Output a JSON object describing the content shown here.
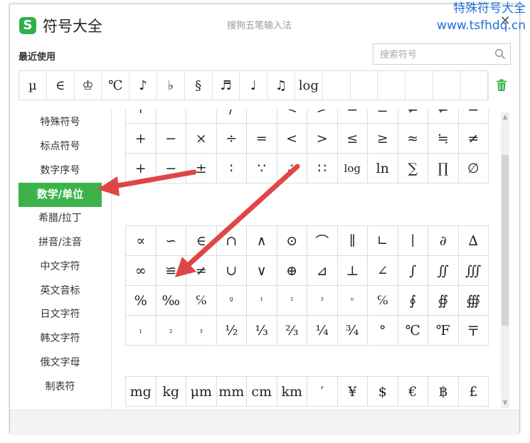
{
  "window": {
    "title": "符号大全",
    "subtitle": "搜狗五笔输入法",
    "close": "✕",
    "logo": "S"
  },
  "watermark": {
    "line1": "特殊符号大全",
    "line2": "www.tsfhdq.cn"
  },
  "recent": {
    "label": "最近使用",
    "items": [
      "µ",
      "∈",
      "♔",
      "℃",
      "♪",
      "♭",
      "§",
      "♬",
      "♩",
      "♫",
      "log",
      "",
      "",
      "",
      "",
      "",
      ""
    ]
  },
  "search": {
    "placeholder": "搜索符号",
    "value": ""
  },
  "sidebar": {
    "items": [
      "特殊符号",
      "标点符号",
      "数字序号",
      "数学/单位",
      "希腊/拉丁",
      "拼音/注音",
      "中文字符",
      "英文音标",
      "日文字符",
      "韩文字符",
      "俄文字母",
      "制表符"
    ],
    "active_index": 3
  },
  "math_block_1": [
    "+",
    "−",
    "°",
    "/",
    "−",
    "<",
    ">",
    "=",
    "≡",
    "≠",
    "≠",
    "=",
    "+",
    "−",
    "×",
    "÷",
    "=",
    "<",
    ">",
    "≤",
    "≥",
    "≈",
    "≒",
    "≠",
    "+",
    "−",
    "±",
    "∶",
    "∵",
    "∴",
    "∷",
    "log",
    "ln",
    "∑",
    "∏",
    "∅"
  ],
  "math_block_2": [
    "∝",
    "∽",
    "∈",
    "∩",
    "∧",
    "⊙",
    "⌒",
    "∥",
    "∟",
    "∣",
    "∂",
    "∆",
    "∞",
    "≌",
    "≠",
    "∪",
    "∨",
    "⊕",
    "⊿",
    "⊥",
    "∠",
    "∫",
    "∬",
    "∭",
    "%",
    "‰",
    "℅",
    "º",
    "¹",
    "²",
    "³",
    "ⁿ",
    "℅",
    "∮",
    "∯",
    "∰",
    "₁",
    "₂",
    "₃",
    "½",
    "⅓",
    "⅔",
    "¼",
    "¾",
    "°",
    "℃",
    "℉",
    "〒"
  ],
  "unit_block": [
    "mg",
    "kg",
    "μm",
    "mm",
    "cm",
    "km",
    "′",
    "¥",
    "$",
    "€",
    "฿",
    "£"
  ],
  "colors": {
    "accent": "#3cb34a",
    "arrow": "#e04646",
    "watermark": "#1e6fd9"
  }
}
